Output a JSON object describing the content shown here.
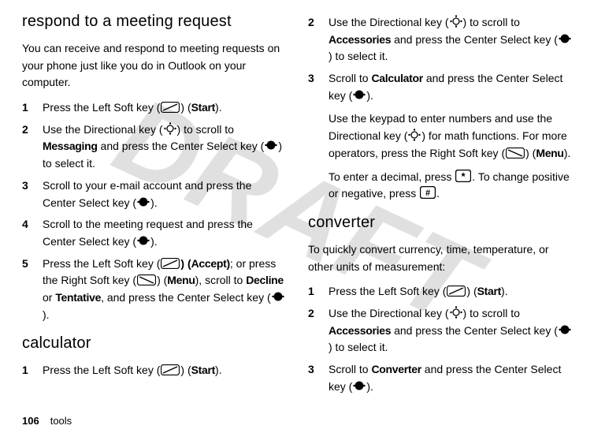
{
  "watermark": "DRAFT",
  "footer": {
    "page_number": "106",
    "section": "tools"
  },
  "left": {
    "h_respond": "respond to a meeting request",
    "lead": "You can receive and respond to meeting requests on your phone just like you do in Outlook on your computer.",
    "s1_a": "Press the Left Soft key (",
    "s1_b": ") (",
    "s1_start": "Start",
    "s1_c": ").",
    "s2_a": "Use the Directional key (",
    "s2_b": ") to scroll to ",
    "s2_messaging": "Messaging",
    "s2_c": " and press the Center Select key (",
    "s2_d": ") to select it.",
    "s3": "Scroll to your e-mail account and press the Center Select key (",
    "s3_b": ").",
    "s4": "Scroll to the meeting request and press the Center Select key (",
    "s4_b": ").",
    "s5_a": "Press the Left Soft key (",
    "s5_b": ") (",
    "s5_accept": "Accept)",
    "s5_c": "; or press the Right Soft key (",
    "s5_d": ") (",
    "s5_menu": "Menu",
    "s5_e": "), scroll to  ",
    "s5_decline": "Decline",
    "s5_f": " or ",
    "s5_tentative": "Tentative",
    "s5_g": ", and press the Center Select key (",
    "s5_h": ").",
    "h_calc": "calculator",
    "c1_a": "Press the Left Soft key (",
    "c1_b": ") (",
    "c1_start": "Start",
    "c1_c": ")."
  },
  "right": {
    "r2_a": "Use the Directional key (",
    "r2_b": ") to scroll to ",
    "r2_acc": "Accessories",
    "r2_c": " and press the Center Select key (",
    "r2_d": ") to select it.",
    "r3_a": "Scroll to ",
    "r3_calc": "Calculator",
    "r3_b": " and press the Center Select key (",
    "r3_c": ").",
    "p1_a": "Use the keypad to enter numbers and use the Directional key (",
    "p1_b": ") for math functions. For more operators, press the Right Soft key (",
    "p1_c": ") (",
    "p1_menu": "Menu",
    "p1_d": ").",
    "p2_a": "To enter a decimal, press ",
    "p2_b": ". To change positive or negative, press ",
    "p2_c": ".",
    "h_conv": "converter",
    "cv_lead": "To quickly convert currency, time, temperature, or other units of measurement:",
    "cv1_a": "Press the Left Soft key (",
    "cv1_b": ") (",
    "cv1_start": "Start",
    "cv1_c": ").",
    "cv2_a": "Use the Directional key (",
    "cv2_b": ") to scroll to ",
    "cv2_acc": "Accessories",
    "cv2_c": " and press the Center Select key (",
    "cv2_d": ") to select it.",
    "cv3_a": "Scroll to ",
    "cv3_conv": "Converter",
    "cv3_b": " and press the Center Select key (",
    "cv3_c": ")."
  },
  "key_star": "*",
  "key_hash": "#"
}
